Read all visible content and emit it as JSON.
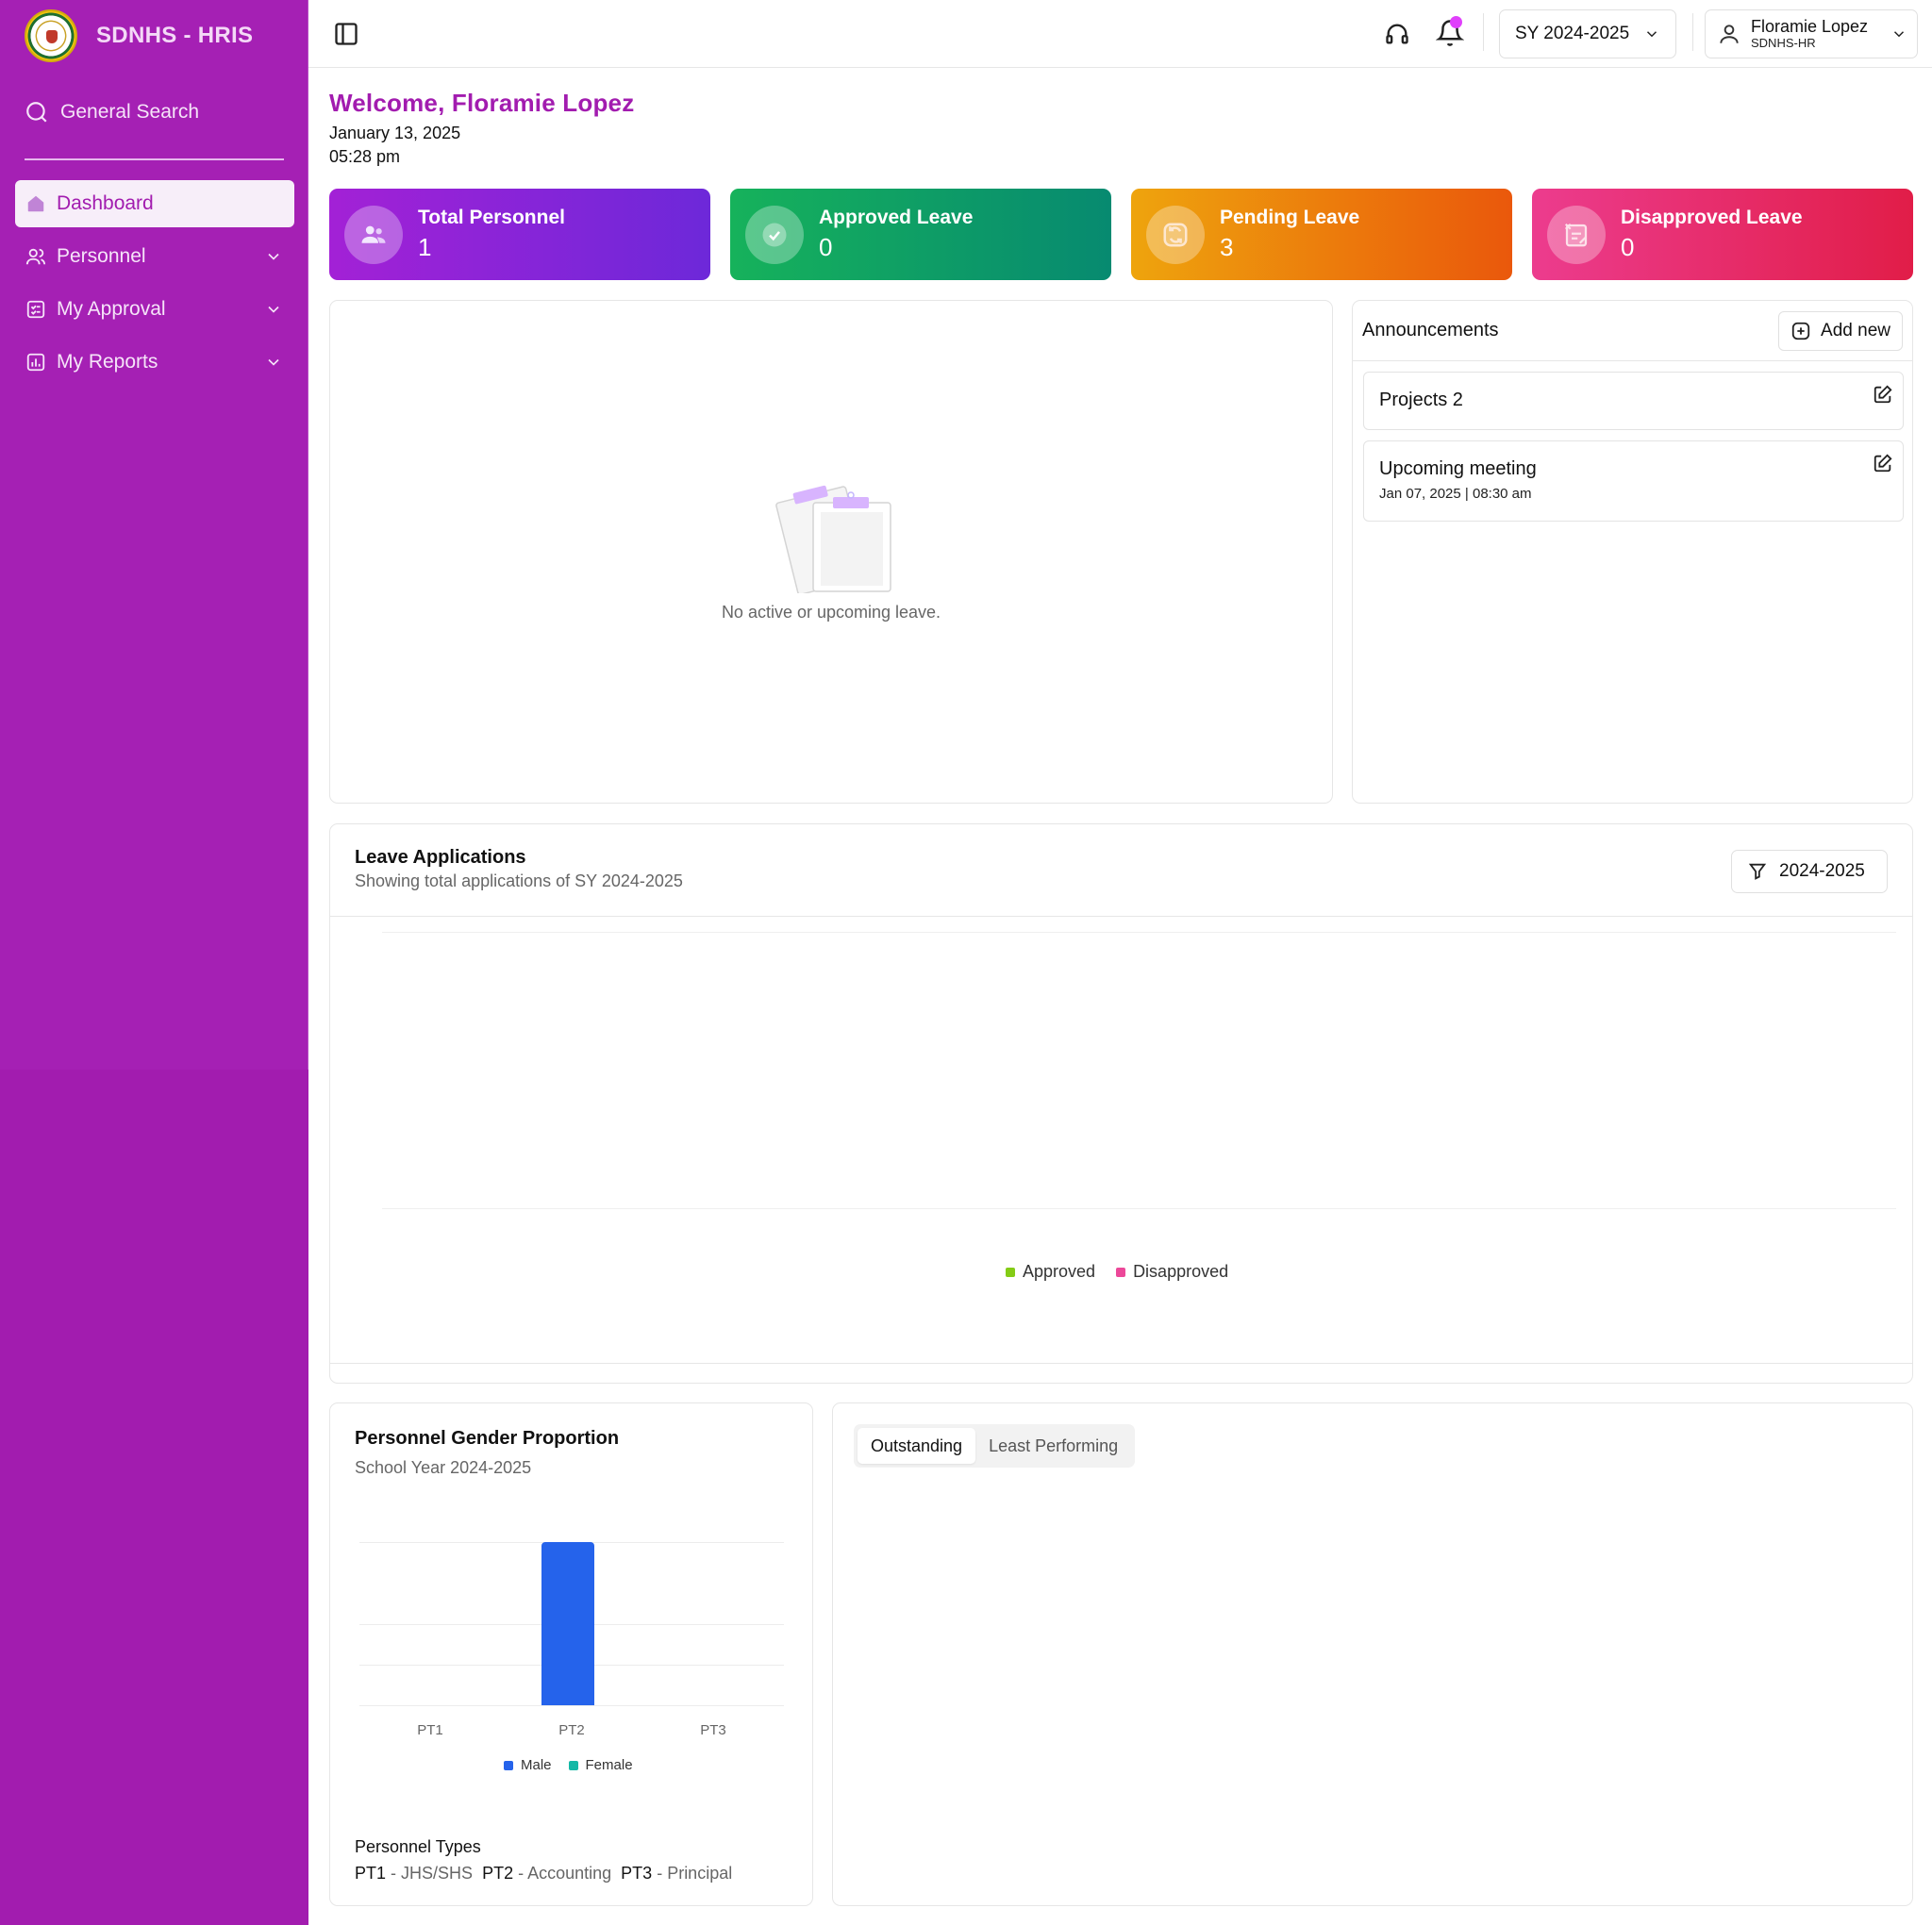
{
  "app": {
    "name": "SDNHS - HRIS"
  },
  "sidebar": {
    "search_label": "General Search",
    "items": [
      {
        "label": "Dashboard",
        "icon": "home-icon",
        "active": true
      },
      {
        "label": "Personnel",
        "icon": "users-icon",
        "expandable": true
      },
      {
        "label": "My Approval",
        "icon": "approval-icon",
        "expandable": true
      },
      {
        "label": "My Reports",
        "icon": "reports-icon",
        "expandable": true
      }
    ]
  },
  "topbar": {
    "school_year": "SY 2024-2025",
    "user": {
      "name": "Floramie Lopez",
      "role": "SDNHS-HR"
    },
    "has_notification": true
  },
  "welcome": {
    "greeting": "Welcome, Floramie Lopez",
    "date": "January 13, 2025",
    "time": "05:28 pm"
  },
  "stats": [
    {
      "title": "Total Personnel",
      "value": "1",
      "icon": "users-icon"
    },
    {
      "title": "Approved Leave",
      "value": "0",
      "icon": "check-icon"
    },
    {
      "title": "Pending Leave",
      "value": "3",
      "icon": "refresh-icon"
    },
    {
      "title": "Disapproved Leave",
      "value": "0",
      "icon": "document-x-icon"
    }
  ],
  "leave": {
    "empty_text": "No active or upcoming leave."
  },
  "announcements": {
    "title": "Announcements",
    "add_label": "Add new",
    "items": [
      {
        "title": "Projects 2",
        "meta": ""
      },
      {
        "title": "Upcoming meeting",
        "meta": "Jan 07, 2025 | 08:30 am"
      }
    ]
  },
  "leave_applications": {
    "title": "Leave Applications",
    "subtitle": "Showing total applications of SY 2024-2025",
    "filter_label": "2024-2025",
    "legend": [
      {
        "name": "Approved",
        "color": "#84cc16"
      },
      {
        "name": "Disapproved",
        "color": "#ec4899"
      }
    ]
  },
  "gender": {
    "title": "Personnel Gender Proportion",
    "subtitle": "School Year 2024-2025",
    "legend": [
      {
        "name": "Male",
        "color": "#2563eb"
      },
      {
        "name": "Female",
        "color": "#14b8a6"
      }
    ],
    "types_title": "Personnel Types",
    "types": [
      {
        "code": "PT1",
        "desc": "JHS/SHS"
      },
      {
        "code": "PT2",
        "desc": "Accounting"
      },
      {
        "code": "PT3",
        "desc": "Principal"
      }
    ]
  },
  "performance": {
    "tabs": [
      {
        "label": "Outstanding",
        "active": true
      },
      {
        "label": "Least Performing",
        "active": false
      }
    ]
  },
  "chart_data": [
    {
      "type": "bar",
      "title": "Leave Applications",
      "categories": [],
      "series": [
        {
          "name": "Approved",
          "values": []
        },
        {
          "name": "Disapproved",
          "values": []
        }
      ]
    },
    {
      "type": "bar",
      "title": "Personnel Gender Proportion",
      "categories": [
        "PT1",
        "PT2",
        "PT3"
      ],
      "series": [
        {
          "name": "Male",
          "values": [
            0,
            1,
            0
          ]
        },
        {
          "name": "Female",
          "values": [
            0,
            0,
            0
          ]
        }
      ],
      "ylim": [
        0,
        1
      ]
    }
  ]
}
